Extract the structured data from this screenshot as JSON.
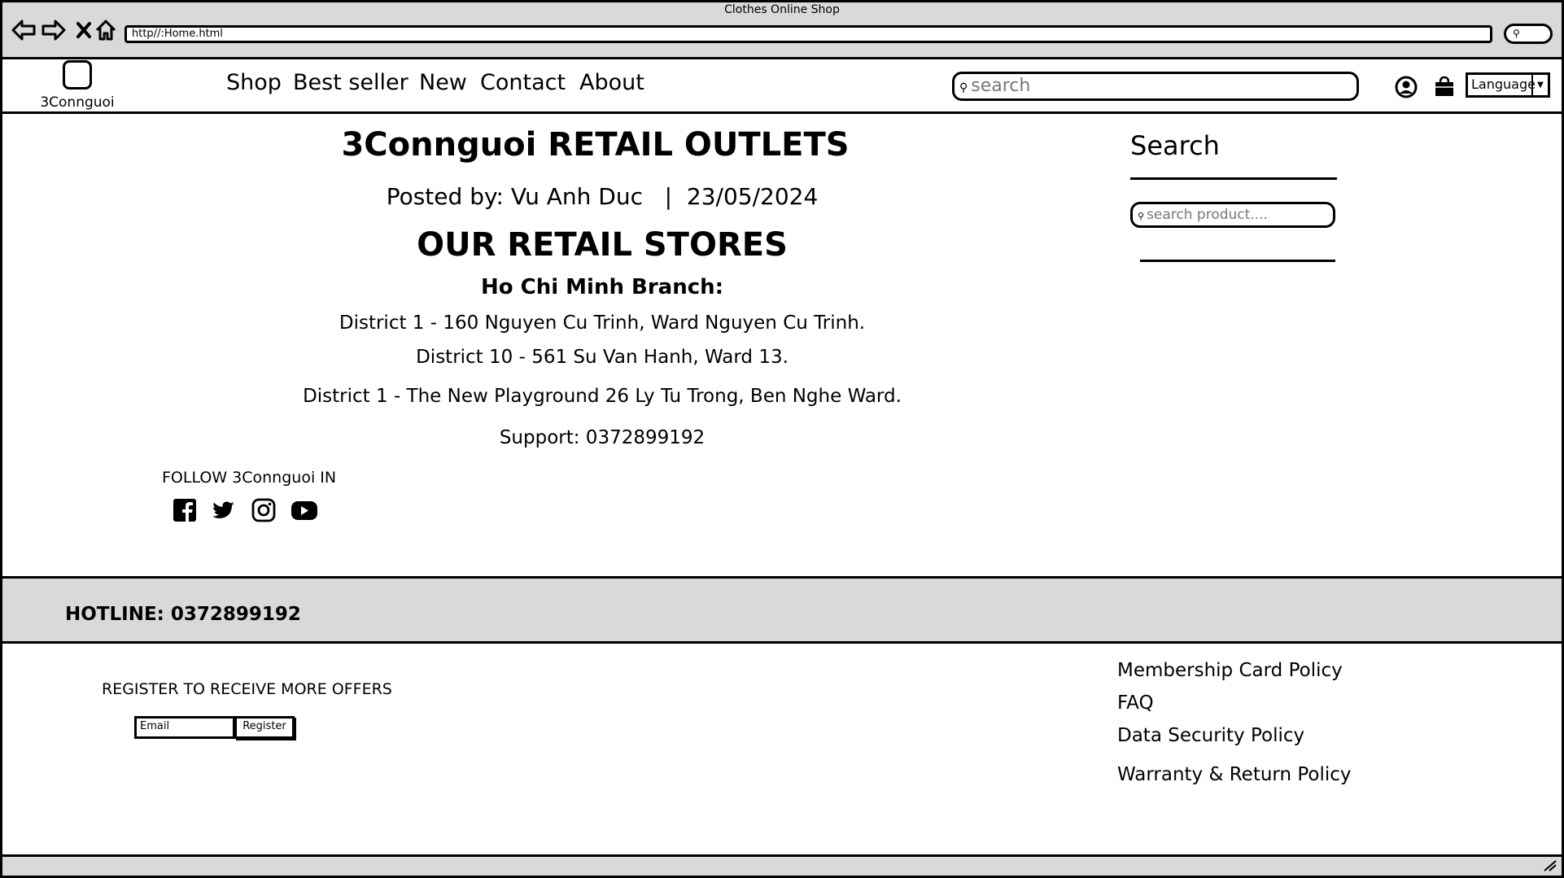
{
  "browser": {
    "title": "Clothes Online Shop",
    "url": "http//:Home.html",
    "nav_icons": [
      "back-arrow-icon",
      "forward-arrow-icon",
      "close-x-icon",
      "home-icon"
    ],
    "search_icon": "search-icon"
  },
  "header": {
    "logo_text": "3Connguoi",
    "nav": [
      "Shop",
      "Best seller",
      "New",
      "Contact",
      "About"
    ],
    "search_placeholder": "search",
    "language_label": "Language"
  },
  "main": {
    "title": "3Connguoi RETAIL OUTLETS",
    "posted": "Posted by: Vu Anh Duc   |  23/05/2024",
    "section_title": "OUR RETAIL STORES",
    "branch": "Ho Chi Minh Branch:",
    "addresses": [
      "District 1 - 160 Nguyen Cu Trinh, Ward Nguyen Cu Trinh.",
      "District 10 - 561 Su Van Hanh, Ward 13.",
      "District 1 - The New Playground 26 Ly Tu Trong, Ben Nghe Ward."
    ],
    "support": "Support: 0372899192",
    "follow_label": "FOLLOW 3Connguoi IN",
    "social_icons": [
      "facebook-icon",
      "twitter-icon",
      "instagram-icon",
      "youtube-icon"
    ]
  },
  "sidebar": {
    "title": "Search",
    "search_placeholder": "search product...."
  },
  "hotline": "HOTLINE: 0372899192",
  "footer": {
    "register_label": "REGISTER TO RECEIVE MORE OFFERS",
    "email_placeholder": "Email",
    "register_button": "Register",
    "links": [
      "Membership Card Policy",
      "FAQ",
      "Data Security Policy",
      "Warranty & Return Policy"
    ]
  },
  "colors": {
    "chrome_gray": "#d9d9d9",
    "ink": "#000000"
  }
}
